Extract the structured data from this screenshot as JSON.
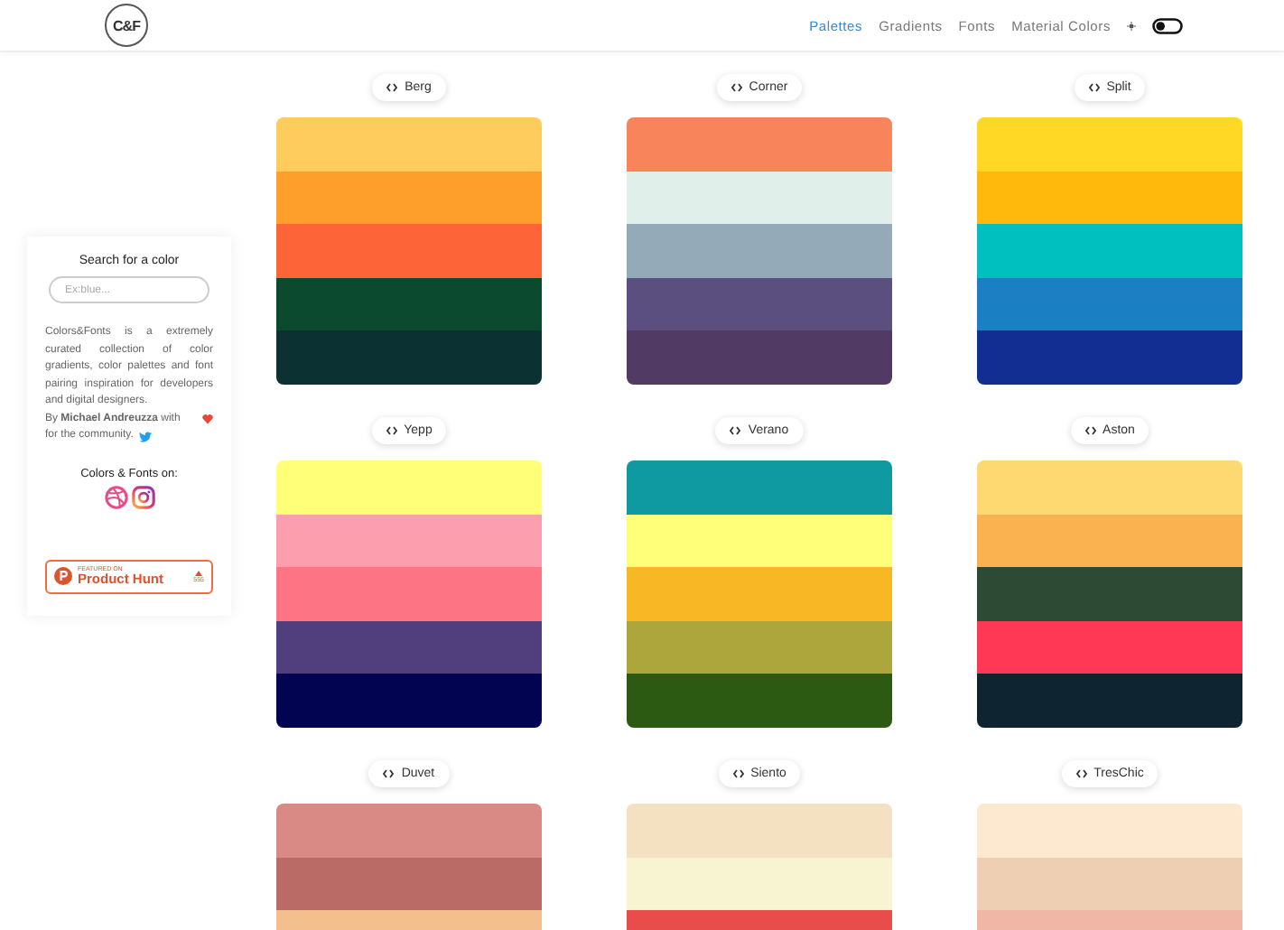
{
  "header": {
    "logo": "C&F",
    "nav": [
      {
        "label": "Palettes",
        "selected": true
      },
      {
        "label": "Gradients",
        "selected": false
      },
      {
        "label": "Fonts",
        "selected": false
      },
      {
        "label": "Material Colors",
        "selected": false
      }
    ],
    "dark_mode": {
      "on": false
    }
  },
  "sidebar": {
    "title": "Search for a color",
    "search": {
      "placeholder": "Ex:blue..."
    },
    "description": "Colors&Fonts is a extremely curated collection of color gradients, color palettes and font pairing inspiration for developers and digital designers.",
    "credit_line_1": "By **Michael Andreuzza** with",
    "credit_line_2": "for the community.",
    "social_title": "Colors & Fonts on:",
    "badge": {
      "caption": "FEATURED ON",
      "name": "Product Hunt",
      "count": "555"
    }
  },
  "palettes": [
    {
      "name": "Berg",
      "stripes": [
        {
          "color": "#fdcc5c"
        },
        {
          "color": "#fd9f2a"
        },
        {
          "color": "#fd6437"
        },
        {
          "color": "#0b4a2f"
        },
        {
          "color": "#0b3132"
        }
      ]
    },
    {
      "name": "Corner",
      "stripes": [
        {
          "color": "#f7845a"
        },
        {
          "color": "#e0efea"
        },
        {
          "color": "#94aab8"
        },
        {
          "color": "#5b4f80"
        },
        {
          "color": "#513b65"
        }
      ]
    },
    {
      "name": "Split",
      "stripes": [
        {
          "color": "#fed825"
        },
        {
          "color": "#ffb90c"
        },
        {
          "color": "#00bfbf"
        },
        {
          "color": "#1b7fc3"
        },
        {
          "color": "#122e93"
        }
      ]
    },
    {
      "name": "Yepp",
      "stripes": [
        {
          "color": "#ffff78"
        },
        {
          "color": "#fd9eaf"
        },
        {
          "color": "#fd7585"
        },
        {
          "color": "#513f7d"
        },
        {
          "color": "#020451"
        }
      ]
    },
    {
      "name": "Verano",
      "stripes": [
        {
          "color": "#0e9aa0"
        },
        {
          "color": "#ffff7a"
        },
        {
          "color": "#f8b724"
        },
        {
          "color": "#aca63c"
        },
        {
          "color": "#2c5a12"
        }
      ]
    },
    {
      "name": "Aston",
      "stripes": [
        {
          "color": "#fed870"
        },
        {
          "color": "#f9b24f"
        },
        {
          "color": "#2d4a35"
        },
        {
          "color": "#ff3855"
        },
        {
          "color": "#0f2431"
        }
      ]
    },
    {
      "name": "Duvet",
      "stripes": [
        {
          "color": "#d98a84"
        },
        {
          "color": "#bb6b66"
        },
        {
          "color": "#f2bf8d"
        }
      ]
    },
    {
      "name": "Siento",
      "stripes": [
        {
          "color": "#f3e1c1"
        },
        {
          "color": "#f8f3d0"
        },
        {
          "color": "#e84c4b"
        }
      ]
    },
    {
      "name": "TresChic",
      "stripes": [
        {
          "color": "#fde9cf"
        },
        {
          "color": "#efcfb4"
        },
        {
          "color": "#f0b6a6"
        }
      ]
    }
  ]
}
